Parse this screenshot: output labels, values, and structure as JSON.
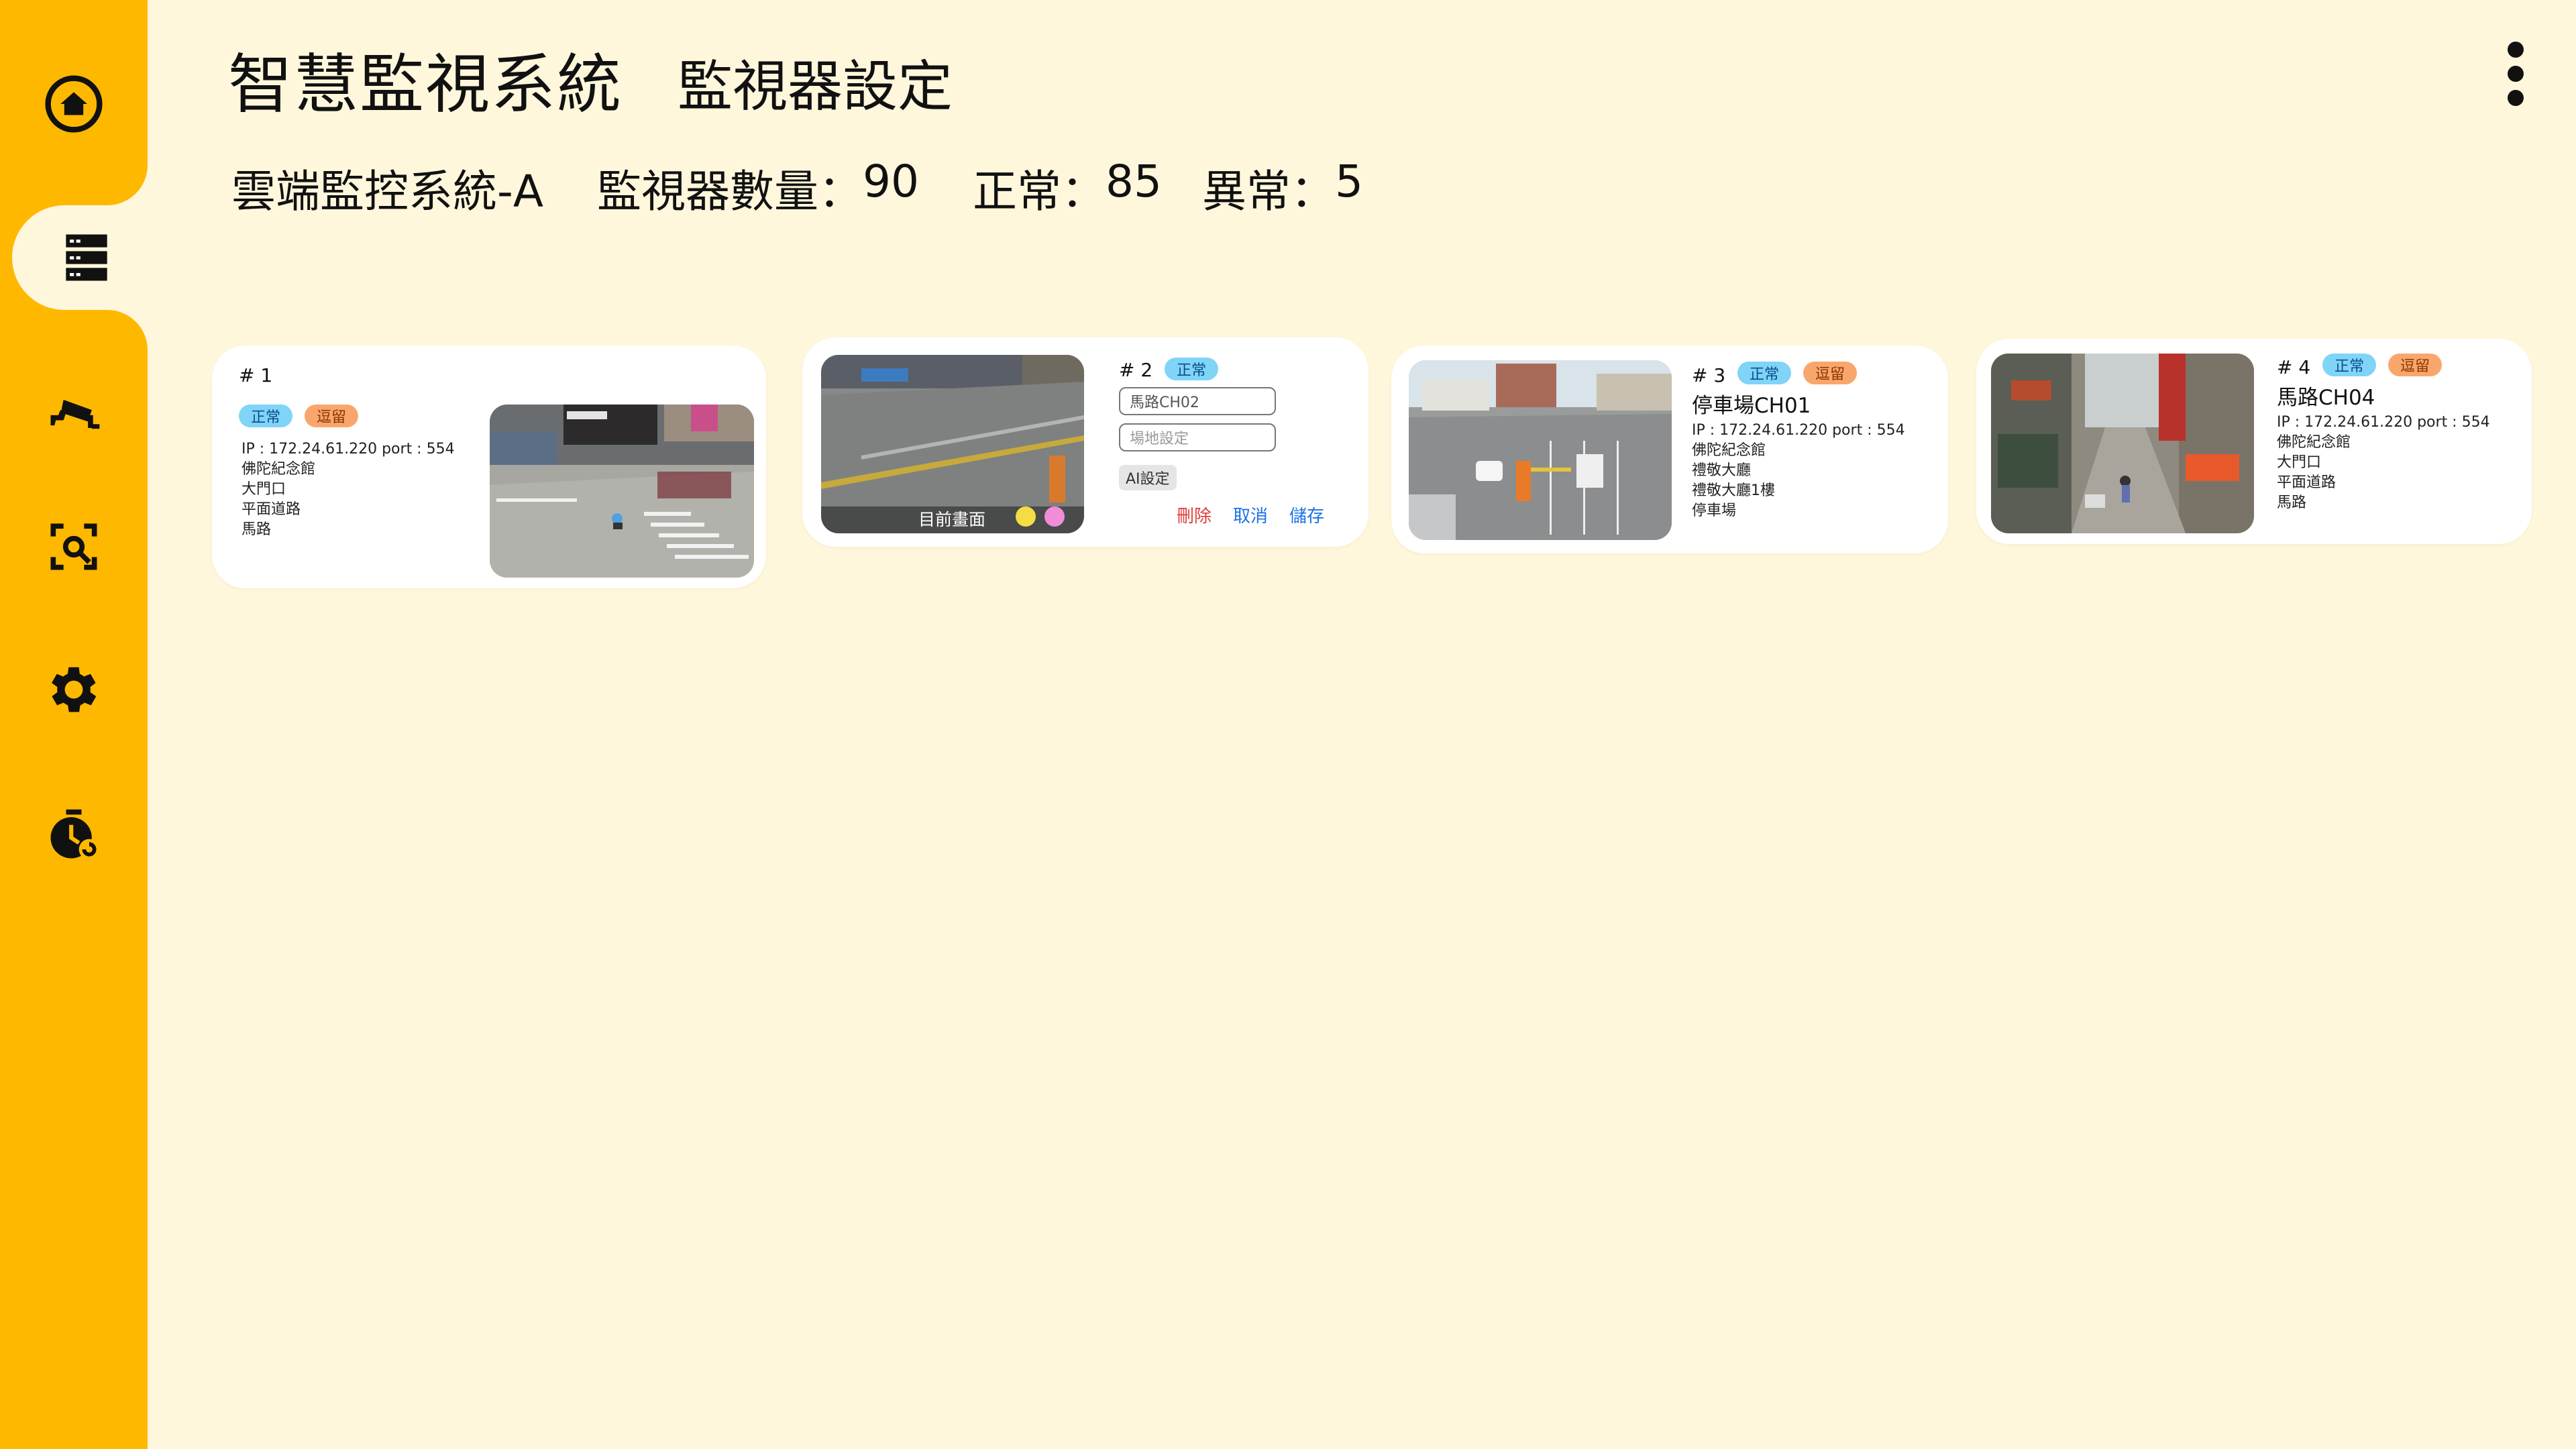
{
  "header": {
    "title": "智慧監視系統",
    "subtitle": "監視器設定"
  },
  "stats": {
    "system_name": "雲端監控系統-A",
    "count_label": "監視器數量：",
    "count_value": "90",
    "normal_label": "正常：",
    "normal_value": "85",
    "abnormal_label": "異常：",
    "abnormal_value": "5"
  },
  "sidebar": {
    "items": [
      {
        "icon": "home-icon",
        "active": false
      },
      {
        "icon": "server-list-icon",
        "active": true
      },
      {
        "icon": "cctv-camera-icon",
        "active": false
      },
      {
        "icon": "scan-search-icon",
        "active": false
      },
      {
        "icon": "gear-icon",
        "active": false
      },
      {
        "icon": "timer-icon",
        "active": false
      }
    ]
  },
  "colors": {
    "sidebar": "#FFB800",
    "background": "#FFF7DC",
    "badge_normal": "#7FD4F8",
    "badge_stay": "#F9A66C",
    "action_delete": "#E23D3D",
    "action_link": "#1A73E8"
  },
  "cards": [
    {
      "number": "# 1",
      "badge_status": "正常",
      "badge_stay": "逗留",
      "ip": "IP : 172.24.61.220 port : 554",
      "tags": [
        "佛陀紀念館",
        "大門口",
        "平面道路",
        "馬路"
      ]
    },
    {
      "number": "# 2",
      "badge_status": "正常",
      "name_value": "馬路CH02",
      "site_placeholder": "場地設定",
      "ai_button": "AI設定",
      "overlay_label": "目前畫面",
      "delete": "刪除",
      "cancel": "取消",
      "save": "儲存"
    },
    {
      "number": "# 3",
      "badge_status": "正常",
      "badge_stay": "逗留",
      "name": "停車場CH01",
      "ip": "IP : 172.24.61.220 port : 554",
      "tags": [
        "佛陀紀念館",
        "禮敬大廳",
        "禮敬大廳1樓",
        "停車場"
      ]
    },
    {
      "number": "# 4",
      "badge_status": "正常",
      "badge_stay": "逗留",
      "name": "馬路CH04",
      "ip": "IP : 172.24.61.220 port : 554",
      "tags": [
        "佛陀紀念館",
        "大門口",
        "平面道路",
        "馬路"
      ]
    }
  ]
}
